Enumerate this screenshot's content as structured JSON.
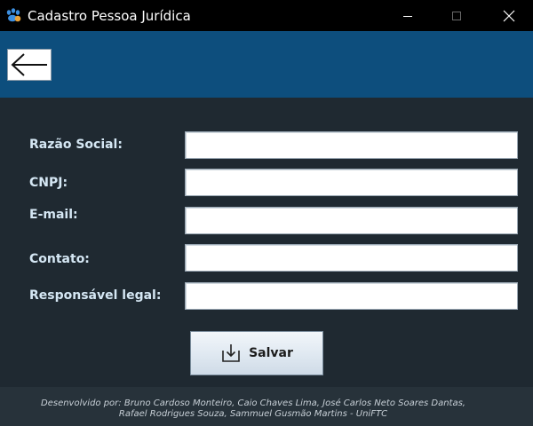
{
  "window": {
    "title": "Cadastro Pessoa Jurídica",
    "app_icon": "paw-app-icon",
    "controls": [
      "minimize",
      "maximize",
      "close"
    ]
  },
  "topbar": {
    "back_icon": "arrow-left-icon"
  },
  "form": {
    "fields": [
      {
        "label": "Razão Social:",
        "value": ""
      },
      {
        "label": "CNPJ:",
        "value": ""
      },
      {
        "label": "E-mail:",
        "value": ""
      },
      {
        "label": "Contato:",
        "value": ""
      },
      {
        "label": "Responsável legal:",
        "value": ""
      }
    ],
    "save_label": "Salvar",
    "save_icon": "download-save-icon"
  },
  "footer": {
    "line1": "Desenvolvido por: Bruno Cardoso Monteiro, Caio Chaves Lima, José Carlos Neto Soares Dantas,",
    "line2": "Rafael Rodrigues Souza, Sammuel Gusmão Martins - UniFTC"
  },
  "colors": {
    "titlebar": "#000000",
    "header": "#0d4e7d",
    "background": "#1f2931",
    "footer": "#27323a",
    "label_text": "#d5e7f4"
  }
}
